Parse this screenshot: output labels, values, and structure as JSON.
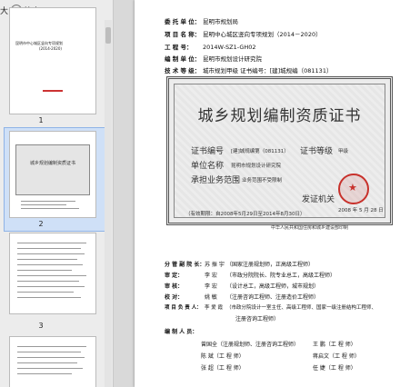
{
  "toolbar": {
    "zoom_in_label": "大",
    "zoom_out_icon": "minus-circle-icon",
    "zoom_out_label": "缩小"
  },
  "thumbnails": [
    {
      "number": "1",
      "title": "昆明市中心城区竖向专项规划",
      "subtitle": "(2014-2020)"
    },
    {
      "number": "2",
      "title": "城乡规划编制资质证书"
    },
    {
      "number": "3"
    }
  ],
  "doc": {
    "rows": [
      {
        "label": "委 托 单 位：",
        "value": "昆明市规划局"
      },
      {
        "label": "项 目 名 称：",
        "value": "昆明中心城区竖向专项规划（2014－2020）"
      },
      {
        "label": "工    程    号：",
        "value": "2014W-SZ1-GH02"
      },
      {
        "label": "编 制 单 位：",
        "value": "昆明市规划设计研究院"
      },
      {
        "label": "技 术 等 级：",
        "value": "城市规划甲级    证书编号：[建]城规编（081131）"
      }
    ],
    "certificate": {
      "title": "城乡规划编制资质证书",
      "cert_no_label": "证书编号",
      "cert_no_value": "[建]城规编第（081131）",
      "grade_label": "证书等级",
      "grade_value": "甲级",
      "unit_label": "单位名称",
      "unit_value": "昆明市规划设计研究院",
      "scope_label": "承担业务范围",
      "scope_value": "业务范围不受限制",
      "issuer_label": "发证机关",
      "issue_date": "2008 年 5 月 28 日",
      "validity": "（有效期限：自2008年5月29日至2014年8月30日）",
      "footer": "中华人民共和国住房和城乡建设部印制"
    },
    "staff": [
      {
        "role": "分 管 副 院 长：",
        "name": "苏 振 宇",
        "note": "（国家注册规划师，正高级工程师）"
      },
      {
        "role": "审          定：",
        "name": "李    宏",
        "note": "（市政分院院长、院专业总工，高级工程师）"
      },
      {
        "role": "审          核：",
        "name": "李    宏",
        "note": "（设计总工，高级工程师，城市规划）"
      },
      {
        "role": "校          对：",
        "name": "姚    敏",
        "note": "（注册咨询工程师、注册造价工程师）"
      },
      {
        "role": "项 目 负 责 人：",
        "name": "李 爱 霞",
        "note": "（市政分院设计一室主任、高级工程师、国家一级注册结构工程师、"
      },
      {
        "role": "",
        "name": "",
        "note": "注册咨询工程师）"
      }
    ],
    "editors_label": "编 制 人 员：",
    "editors": [
      [
        "曾国全（注册规划师、注册咨询工程师）",
        "王    鹏（工    程    师）"
      ],
      [
        "陈    斌（工    程    师）",
        "蒋启文（工    程    师）"
      ],
      [
        "张    超（工    程    师）",
        "任    婕（工    程    师）"
      ]
    ]
  }
}
